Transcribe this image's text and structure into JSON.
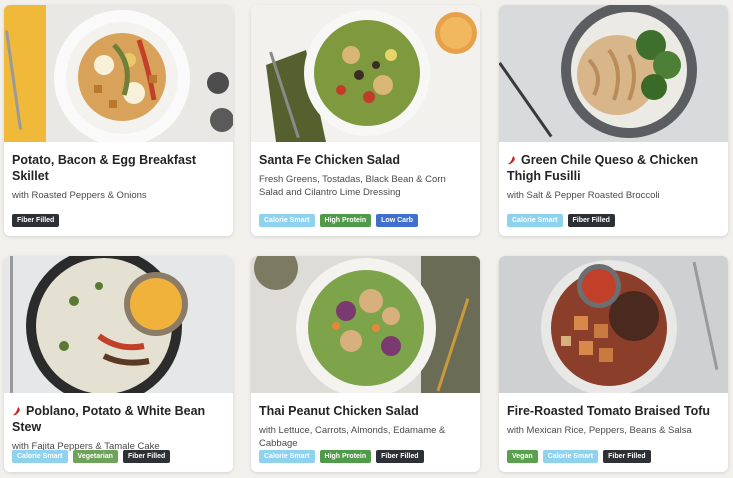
{
  "colors": {
    "background": "#f1f0ec",
    "tag_calorie_smart": "#8fd2f0",
    "tag_high_protein": "#4f9b4a",
    "tag_low_carb": "#3f6fcf",
    "tag_fiber_filled": "#2d3135",
    "tag_vegetarian": "#6da35a",
    "tag_vegan": "#5aa04f",
    "spicy": "#c8261c"
  },
  "meals": [
    {
      "title": "Potato, Bacon & Egg Breakfast Skillet",
      "subtitle": "with Roasted Peppers & Onions",
      "spicy": false,
      "tags": [
        {
          "label": "Fiber Filled",
          "kind": "fiber"
        }
      ]
    },
    {
      "title": "Santa Fe Chicken Salad",
      "subtitle": "Fresh Greens, Tostadas, Black Bean & Corn Salad and Cilantro Lime Dressing",
      "spicy": false,
      "tags": [
        {
          "label": "Calorie Smart",
          "kind": "calorie"
        },
        {
          "label": "High Protein",
          "kind": "protein"
        },
        {
          "label": "Low Carb",
          "kind": "lowcarb"
        }
      ]
    },
    {
      "title": "Green Chile Queso & Chicken Thigh Fusilli",
      "subtitle": "with Salt & Pepper Roasted Broccoli",
      "spicy": true,
      "tags": [
        {
          "label": "Calorie Smart",
          "kind": "calorie"
        },
        {
          "label": "Fiber Filled",
          "kind": "fiber"
        }
      ]
    },
    {
      "title": "Poblano, Potato & White Bean Stew",
      "subtitle": "with Fajita Peppers & Tamale Cake",
      "spicy": true,
      "tags": [
        {
          "label": "Calorie Smart",
          "kind": "calorie"
        },
        {
          "label": "Vegetarian",
          "kind": "vegetarian"
        },
        {
          "label": "Fiber Filled",
          "kind": "fiber"
        }
      ]
    },
    {
      "title": "Thai Peanut Chicken Salad",
      "subtitle": "with Lettuce, Carrots, Almonds, Edamame & Cabbage",
      "spicy": false,
      "tags": [
        {
          "label": "Calorie Smart",
          "kind": "calorie"
        },
        {
          "label": "High Protein",
          "kind": "protein"
        },
        {
          "label": "Fiber Filled",
          "kind": "fiber"
        }
      ]
    },
    {
      "title": "Fire-Roasted Tomato Braised Tofu",
      "subtitle": "with Mexican Rice, Peppers, Beans & Salsa",
      "spicy": false,
      "tags": [
        {
          "label": "Vegan",
          "kind": "vegan"
        },
        {
          "label": "Calorie Smart",
          "kind": "calorie"
        },
        {
          "label": "Fiber Filled",
          "kind": "fiber"
        }
      ]
    }
  ]
}
